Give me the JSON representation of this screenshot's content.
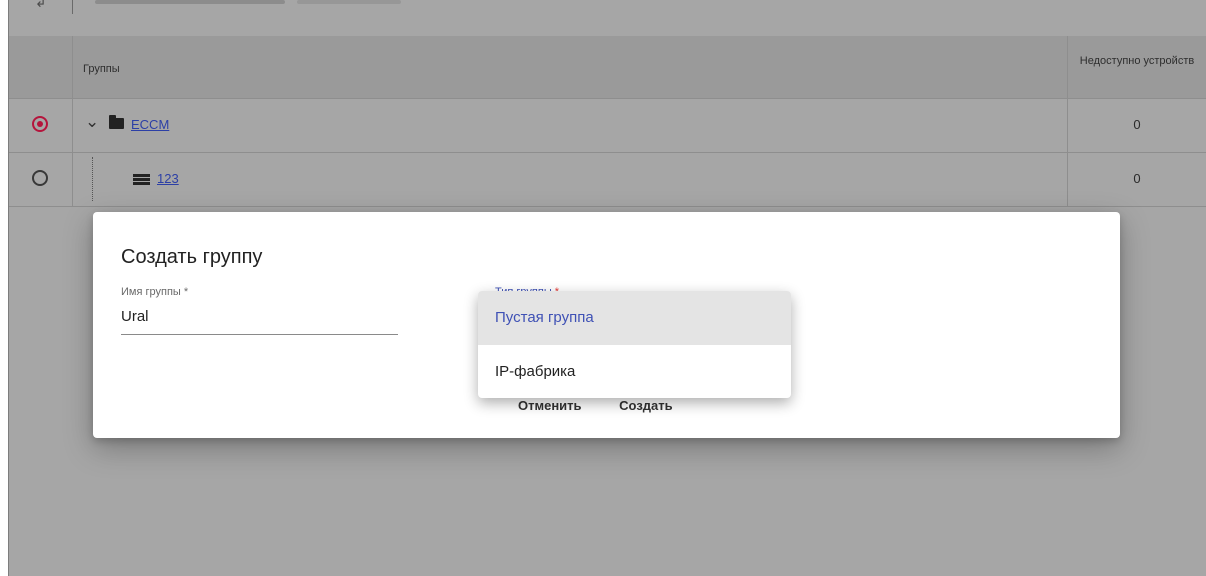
{
  "table": {
    "columns": {
      "groups": "Группы",
      "unavailable": "Недоступно устройств"
    },
    "rows": [
      {
        "name": "ECCM",
        "unavailable": "0",
        "selected": true,
        "expanded": true,
        "icon": "folder-icon"
      },
      {
        "name": "123",
        "unavailable": "0",
        "selected": false,
        "icon": "list-icon"
      }
    ]
  },
  "dialog": {
    "title": "Создать группу",
    "name_label": "Имя группы *",
    "name_value": "Ural",
    "type_label": "Тип группы",
    "type_required": "*",
    "cancel": "Отменить",
    "create": "Создать"
  },
  "menu": {
    "options": [
      {
        "label": "Пустая группа",
        "selected": true
      },
      {
        "label": "IP-фабрика",
        "selected": false
      }
    ]
  },
  "colors": {
    "accent": "#3f51b5",
    "radio_checked": "#b5143c",
    "link": "#2c3fa6"
  }
}
